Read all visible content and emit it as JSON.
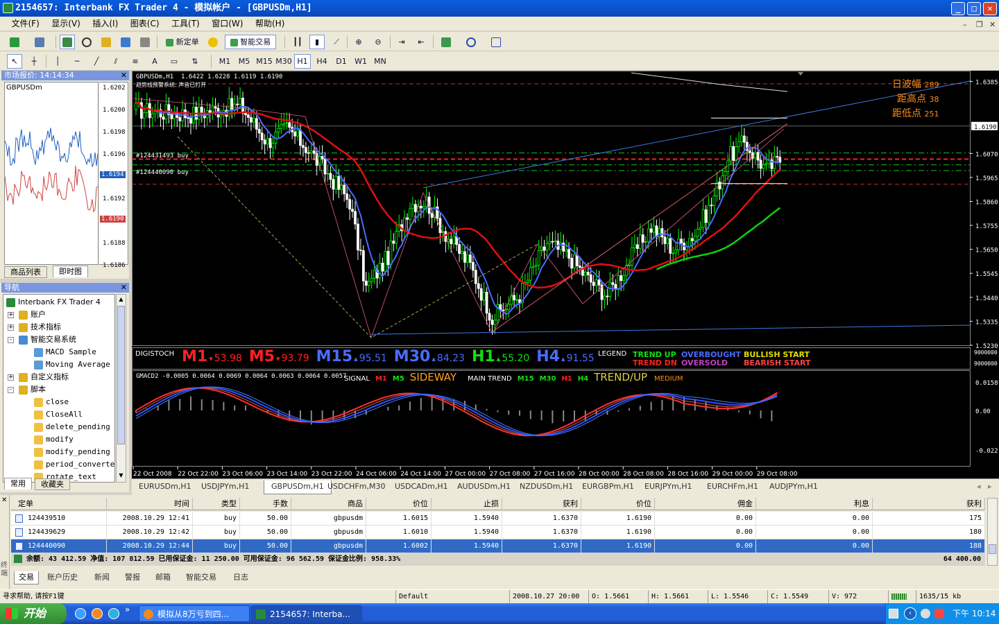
{
  "window": {
    "title": "2154657: Interbank FX Trader 4 - 模拟帐户 - [GBPUSDm,H1]"
  },
  "menu": [
    "文件(F)",
    "显示(V)",
    "插入(I)",
    "图表(C)",
    "工具(T)",
    "窗口(W)",
    "帮助(H)"
  ],
  "toolbar": {
    "new_order": "新定单",
    "expert_advisors": "智能交易",
    "timeframes": [
      "M1",
      "M5",
      "M15",
      "M30",
      "H1",
      "H4",
      "D1",
      "W1",
      "MN"
    ],
    "active_timeframe": "H1",
    "text_tool": "A"
  },
  "market_watch": {
    "header": "市场报价: 14:14:34",
    "symbol": "GBPUSDm",
    "axis_labels": [
      "1.6202",
      "1.6200",
      "1.6198",
      "1.6196",
      "1.6194",
      "1.6192",
      "1.6190",
      "1.6188",
      "1.6186"
    ],
    "ask": "1.6194",
    "bid": "1.6190",
    "tabs": [
      "商品列表",
      "即时图"
    ],
    "active_tab": "即时图"
  },
  "navigator": {
    "header": "导航",
    "items": [
      {
        "label": "Interbank FX Trader 4",
        "level": 0,
        "icon": "terminal-icon"
      },
      {
        "label": "账户",
        "level": 1,
        "icon": "accounts-icon",
        "exp": "+"
      },
      {
        "label": "技术指标",
        "level": 1,
        "icon": "indicators-icon",
        "exp": "+"
      },
      {
        "label": "智能交易系统",
        "level": 1,
        "icon": "experts-icon",
        "exp": "-"
      },
      {
        "label": "MACD Sample",
        "level": 2,
        "icon": "expert-icon"
      },
      {
        "label": "Moving Average",
        "level": 2,
        "icon": "expert-icon"
      },
      {
        "label": "自定义指标",
        "level": 1,
        "icon": "custom-indicators-icon",
        "exp": "+"
      },
      {
        "label": "脚本",
        "level": 1,
        "icon": "scripts-icon",
        "exp": "-"
      },
      {
        "label": "close",
        "level": 2,
        "icon": "script-icon"
      },
      {
        "label": "CloseAll",
        "level": 2,
        "icon": "script-icon"
      },
      {
        "label": "delete_pending",
        "level": 2,
        "icon": "script-icon"
      },
      {
        "label": "modify",
        "level": 2,
        "icon": "script-icon"
      },
      {
        "label": "modify_pending",
        "level": 2,
        "icon": "script-icon"
      },
      {
        "label": "period_converter",
        "level": 2,
        "icon": "script-icon"
      },
      {
        "label": "rotate_text",
        "level": 2,
        "icon": "script-icon"
      }
    ],
    "tabs": [
      "常用",
      "收藏夹"
    ],
    "active_tab": "常用"
  },
  "chart": {
    "header": "GBPUSDm,H1",
    "ohlc": "1.6422 1.6228 1.6119 1.6190",
    "subheader": "趋势线预警系统: 声音已打开",
    "info": [
      {
        "label": "日波幅",
        "value": "289"
      },
      {
        "label": "距高点",
        "value": "38"
      },
      {
        "label": "距低点",
        "value": "251"
      }
    ],
    "price_axis": [
      "1.6385",
      "1.6070",
      "1.5965",
      "1.5860",
      "1.5755",
      "1.5650",
      "1.5545",
      "1.5440",
      "1.5335",
      "1.5230"
    ],
    "current_price": "1.6190",
    "order_labels": [
      "#124431493 buy",
      "#124440090 buy"
    ],
    "time_axis": [
      "22 Oct 2008",
      "22 Oct 22:00",
      "23 Oct 06:00",
      "23 Oct 14:00",
      "23 Oct 22:00",
      "24 Oct 06:00",
      "24 Oct 14:00",
      "27 Oct 00:00",
      "27 Oct 08:00",
      "27 Oct 16:00",
      "28 Oct 00:00",
      "28 Oct 08:00",
      "28 Oct 16:00",
      "29 Oct 00:00",
      "29 Oct 08:00"
    ],
    "colors": {
      "bull": "#00ff00",
      "bear": "#ffffff",
      "ma_red": "#e01010",
      "ma_blue": "#4a6cff",
      "ma_green": "#10d010",
      "info": "#ff8c1a"
    }
  },
  "digistoch": {
    "title": "DIGISTOCH",
    "items": [
      {
        "tf": "M1",
        "dir": "▾",
        "value": "53.98",
        "color": "#ff2020"
      },
      {
        "tf": "M5",
        "dir": "▾",
        "value": "93.79",
        "color": "#ff2020"
      },
      {
        "tf": "M15",
        "dir": "▴",
        "value": "95.51",
        "color": "#4a6cff"
      },
      {
        "tf": "M30",
        "dir": "▴",
        "value": "84.23",
        "color": "#4a6cff"
      },
      {
        "tf": "H1",
        "dir": "▴",
        "value": "55.20",
        "color": "#10e010"
      },
      {
        "tf": "H4",
        "dir": "▴",
        "value": "91.55",
        "color": "#4a6cff"
      }
    ],
    "legend_label": "LEGEND",
    "legend": [
      {
        "text": "TREND UP",
        "color": "#10e010"
      },
      {
        "text": "TREND DN",
        "color": "#ff2020"
      },
      {
        "text": "OVERBOUGHT",
        "color": "#4a6cff"
      },
      {
        "text": "OVERSOLD",
        "color": "#c040c0"
      },
      {
        "text": "BULLISH START",
        "color": "#e0e000"
      },
      {
        "text": "BEARISH START",
        "color": "#ff4040"
      }
    ],
    "axis": [
      "9000000",
      "9000000"
    ]
  },
  "gmacd": {
    "header": "GMACD2 -0.0005 0.0064 0.0069 0.0064 0.0063 0.0064 0.0057",
    "signal_label": "SIGNAL",
    "signal_tfs": [
      {
        "text": "M1",
        "color": "#ff2020"
      },
      {
        "text": "M5",
        "color": "#10e010"
      }
    ],
    "signal_state": "SIDEWAY",
    "main_label": "MAIN TREND",
    "main_tfs": [
      {
        "text": "M15",
        "color": "#10e010"
      },
      {
        "text": "M30",
        "color": "#10e010"
      },
      {
        "text": "H1",
        "color": "#ff2020"
      },
      {
        "text": "H4",
        "color": "#10e010"
      }
    ],
    "main_state": "TREND/UP",
    "strength": "MEDIUM",
    "axis": [
      "0.0158",
      "0.00",
      "-0.022"
    ]
  },
  "symbol_tabs": [
    "EURUSDm,H1",
    "USDJPYm,H1",
    "GBPUSDm,H1",
    "USDCHFm,M30",
    "USDCADm,H1",
    "AUDUSDm,H1",
    "NZDUSDm,H1",
    "EURGBPm,H1",
    "EURJPYm,H1",
    "EURCHFm,H1",
    "AUDJPYm,H1"
  ],
  "active_symbol_tab": "GBPUSDm,H1",
  "terminal": {
    "side_label": "终端",
    "columns": [
      "定单",
      "时间",
      "类型",
      "手数",
      "商品",
      "价位",
      "止损",
      "获利",
      "价位",
      "佣金",
      "利息",
      "获利"
    ],
    "rows": [
      [
        "124439510",
        "2008.10.29 12:41",
        "buy",
        "50.00",
        "gbpusdm",
        "1.6015",
        "1.5940",
        "1.6370",
        "1.6190",
        "0.00",
        "0.00",
        "175"
      ],
      [
        "124439629",
        "2008.10.29 12:42",
        "buy",
        "50.00",
        "gbpusdm",
        "1.6010",
        "1.5940",
        "1.6370",
        "1.6190",
        "0.00",
        "0.00",
        "180"
      ],
      [
        "124440090",
        "2008.10.29 12:44",
        "buy",
        "50.00",
        "gbpusdm",
        "1.6002",
        "1.5940",
        "1.6370",
        "1.6190",
        "0.00",
        "0.00",
        "188"
      ]
    ],
    "selected_row": 2,
    "balance_line": "余额: 43 412.59  净值: 107 812.59  已用保证金: 11 250.00  可用保证金: 96 562.59  保证金比例: 958.33%",
    "total_profit": "64 400.00",
    "tabs": [
      "交易",
      "账户历史",
      "新闻",
      "警报",
      "邮箱",
      "智能交易",
      "日志"
    ],
    "active_tab": "交易"
  },
  "status": {
    "help": "寻求帮助, 请按F1键",
    "profile": "Default",
    "datetime": "2008.10.27 20:00",
    "open": "O: 1.5661",
    "high": "H: 1.5661",
    "low": "L: 1.5546",
    "close": "C: 1.5549",
    "volume": "V: 972",
    "traffic": "1635/15 kb"
  },
  "taskbar": {
    "start": "开始",
    "tasks": [
      "模拟从8万亏到四...",
      "2154657: Interba..."
    ],
    "active_task": 1,
    "clock": "下午 10:14"
  }
}
